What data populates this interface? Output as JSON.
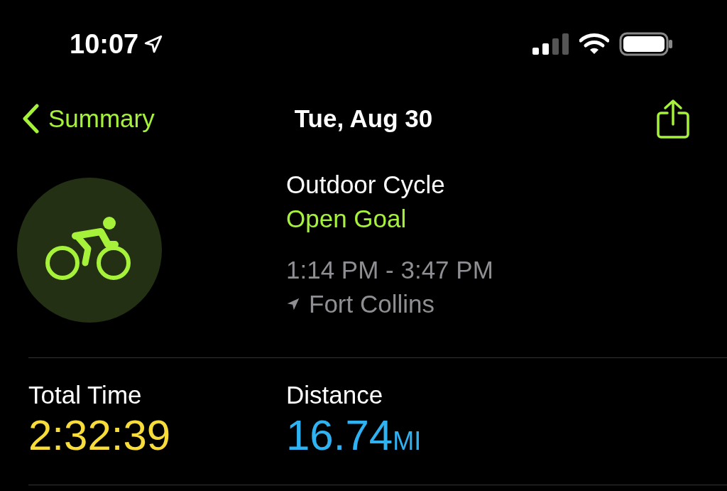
{
  "status_bar": {
    "time": "10:07"
  },
  "nav": {
    "back_label": "Summary",
    "title": "Tue, Aug 30"
  },
  "workout": {
    "name": "Outdoor Cycle",
    "goal": "Open Goal",
    "time_range": "1:14 PM - 3:47 PM",
    "location": "Fort Collins"
  },
  "stats": [
    {
      "label": "Total Time",
      "value": "2:32:39",
      "color": "#f7dc3a"
    },
    {
      "label": "Distance",
      "value": "16.74",
      "unit": "MI",
      "color": "#2fb2f2"
    }
  ]
}
